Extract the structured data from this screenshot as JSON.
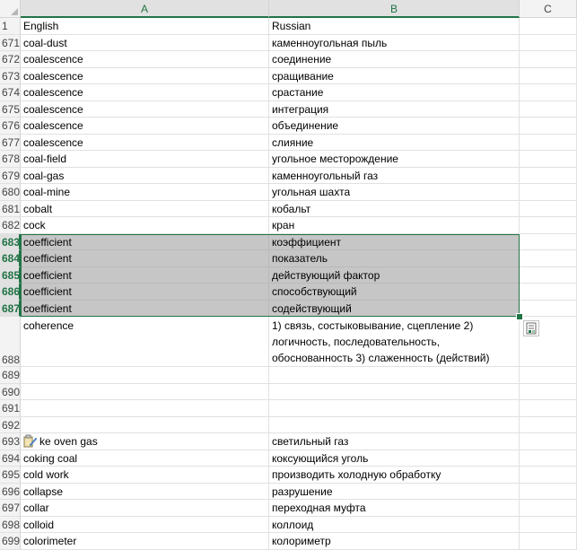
{
  "columns": [
    {
      "label": "A",
      "selected": true
    },
    {
      "label": "B",
      "selected": true
    },
    {
      "label": "C",
      "selected": false
    }
  ],
  "rows": [
    {
      "num": "1",
      "a": "English",
      "b": "Russian",
      "selected": false
    },
    {
      "num": "671",
      "a": "coal-dust",
      "b": "каменноугольная пыль",
      "selected": false
    },
    {
      "num": "672",
      "a": "coalescence",
      "b": "соединение",
      "selected": false
    },
    {
      "num": "673",
      "a": "coalescence",
      "b": "сращивание",
      "selected": false
    },
    {
      "num": "674",
      "a": "coalescence",
      "b": "срастание",
      "selected": false
    },
    {
      "num": "675",
      "a": "coalescence",
      "b": "интеграция",
      "selected": false
    },
    {
      "num": "676",
      "a": "coalescence",
      "b": "объединение",
      "selected": false
    },
    {
      "num": "677",
      "a": "coalescence",
      "b": "слияние",
      "selected": false
    },
    {
      "num": "678",
      "a": "coal-field",
      "b": "угольное месторождение",
      "selected": false
    },
    {
      "num": "679",
      "a": "coal-gas",
      "b": "каменноугольный газ",
      "selected": false
    },
    {
      "num": "680",
      "a": "coal-mine",
      "b": "угольная шахта",
      "selected": false
    },
    {
      "num": "681",
      "a": "cobalt",
      "b": "кобальт",
      "selected": false
    },
    {
      "num": "682",
      "a": "cock",
      "b": "кран",
      "selected": false
    },
    {
      "num": "683",
      "a": "coefficient",
      "b": "коэффициент",
      "selected": true
    },
    {
      "num": "684",
      "a": "coefficient",
      "b": "показатель",
      "selected": true
    },
    {
      "num": "685",
      "a": "coefficient",
      "b": "действующий фактор",
      "selected": true
    },
    {
      "num": "686",
      "a": "coefficient",
      "b": "способствующий",
      "selected": true
    },
    {
      "num": "687",
      "a": "coefficient",
      "b": "содействующий",
      "selected": true
    },
    {
      "num": "688",
      "a": "coherence",
      "b": "1) связь, состыковывание, сцепление 2) логичность, последовательность, обоснованность 3) слаженность (действий)",
      "selected": false,
      "tall": true
    },
    {
      "num": "689",
      "a": "",
      "b": "",
      "selected": false
    },
    {
      "num": "690",
      "a": "",
      "b": "",
      "selected": false
    },
    {
      "num": "691",
      "a": "",
      "b": "",
      "selected": false
    },
    {
      "num": "692",
      "a": "",
      "b": "",
      "selected": false
    },
    {
      "num": "693",
      "a": "ke oven gas",
      "b": "светильный газ",
      "selected": false
    },
    {
      "num": "694",
      "a": "coking coal",
      "b": "коксующийся уголь",
      "selected": false
    },
    {
      "num": "695",
      "a": "cold work",
      "b": "производить холодную обработку",
      "selected": false
    },
    {
      "num": "696",
      "a": "collapse",
      "b": "разрушение",
      "selected": false
    },
    {
      "num": "697",
      "a": "collar",
      "b": "переходная муфта",
      "selected": false
    },
    {
      "num": "698",
      "a": "colloid",
      "b": "коллоид",
      "selected": false
    },
    {
      "num": "699",
      "a": "colorimeter",
      "b": "колориметр",
      "selected": false
    }
  ],
  "icons": {
    "quick_analysis": "quick-analysis-icon",
    "paste_options": "paste-options-icon"
  },
  "colors": {
    "accent": "#217346",
    "selection_fill": "#c6c6c6",
    "header_bg": "#f3f3f3"
  }
}
